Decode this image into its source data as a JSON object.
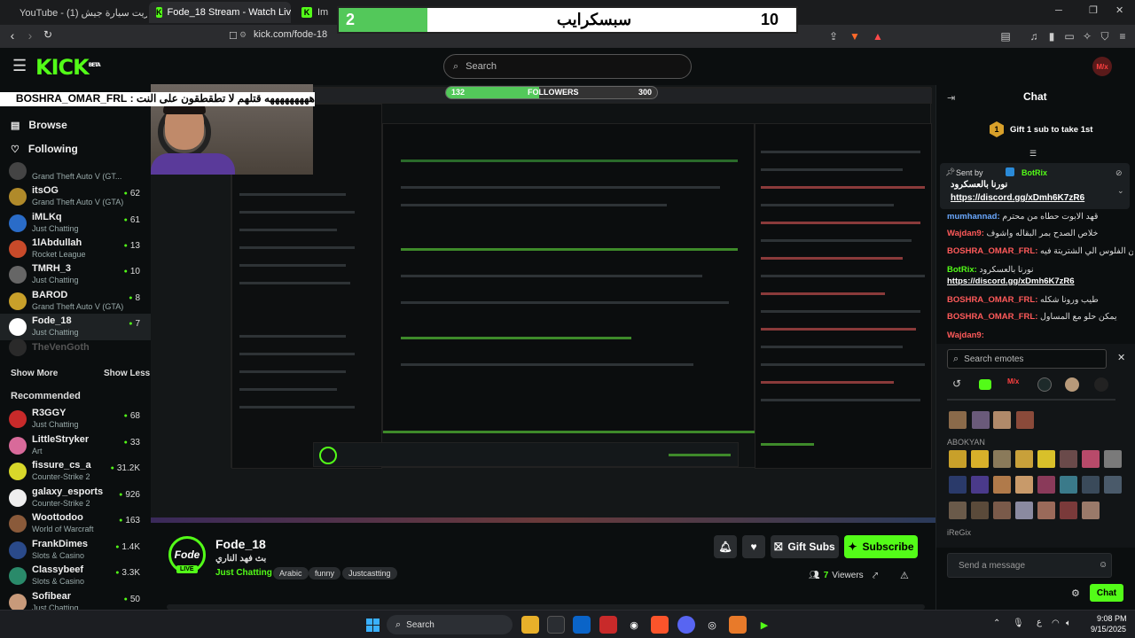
{
  "browser": {
    "tabs": [
      {
        "label": "YouTube - شريت سيارة جيش (1)"
      },
      {
        "label": "Fode_18 Stream - Watch Live"
      },
      {
        "label": "Im"
      }
    ],
    "url": "kick.com/fode-18",
    "new_tab": "+"
  },
  "scoreboard": {
    "left_value": "2",
    "title": "سبسكرايب",
    "right_value": "10"
  },
  "header": {
    "logo": "KICK",
    "logo_badge": "BETA",
    "search_placeholder": "Search",
    "avatar_text": "M/x"
  },
  "sidebar": {
    "browse": "Browse",
    "following": "Following",
    "followed_channels": [
      {
        "name": "",
        "category": "Grand Theft Auto V (GT...",
        "viewers": "",
        "color": "#444"
      },
      {
        "name": "itsOG",
        "category": "Grand Theft Auto V (GTA)",
        "viewers": "62",
        "color": "#b08a2a"
      },
      {
        "name": "iMLKq",
        "category": "Just Chatting",
        "viewers": "61",
        "color": "#2a6cc8"
      },
      {
        "name": "1lAbdullah",
        "category": "Rocket League",
        "viewers": "13",
        "color": "#c84a2a"
      },
      {
        "name": "TMRH_3",
        "category": "Just Chatting",
        "viewers": "10",
        "color": "#666"
      },
      {
        "name": "BAROD",
        "category": "Grand Theft Auto V (GTA)",
        "viewers": "8",
        "color": "#c8a02a"
      },
      {
        "name": "Fode_18",
        "category": "Just Chatting",
        "viewers": "7",
        "color": "#fff"
      }
    ],
    "offline_channel": "TheVenGoth",
    "show_more": "Show More",
    "show_less": "Show Less",
    "recommended_title": "Recommended",
    "recommended": [
      {
        "name": "R3GGY",
        "category": "Just Chatting",
        "viewers": "68",
        "color": "#c82a2a"
      },
      {
        "name": "LittleStryker",
        "category": "Art",
        "viewers": "33",
        "color": "#d86a9a"
      },
      {
        "name": "fissure_cs_a",
        "category": "Counter-Strike 2",
        "viewers": "31.2K",
        "color": "#d8d82a"
      },
      {
        "name": "galaxy_esports",
        "category": "Counter-Strike 2",
        "viewers": "926",
        "color": "#eee"
      },
      {
        "name": "Woottodoo",
        "category": "World of Warcraft",
        "viewers": "163",
        "color": "#8a5a3a"
      },
      {
        "name": "FrankDimes",
        "category": "Slots & Casino",
        "viewers": "1.4K",
        "color": "#2a4a8a"
      },
      {
        "name": "Classybeef",
        "category": "Slots & Casino",
        "viewers": "3.3K",
        "color": "#2a8a6a"
      },
      {
        "name": "Sofibear",
        "category": "Just Chatting",
        "viewers": "50",
        "color": "#c89a7a"
      }
    ]
  },
  "overlay": {
    "ticker": "هههههههههه قتلهم لا تطقطقون على النت : BOSHRA_OMAR_FRL",
    "followers_label": "FOLLOWERS",
    "followers_current": "132",
    "followers_goal": "300",
    "followers_progress": 0.44
  },
  "stream": {
    "avatar_text": "Fode",
    "live": "LIVE",
    "name": "Fode_18",
    "title": "بث فهد الناري",
    "category": "Just Chatting",
    "tags": [
      "Arabic",
      "funny",
      "Justcastting"
    ],
    "gift_subs": "Gift Subs",
    "subscribe": "Subscribe",
    "viewers": "7",
    "viewers_label": "Viewers"
  },
  "chat": {
    "title": "Chat",
    "gift_banner": "Gift 1 sub to take 1st",
    "gift_count": "1",
    "pinned_by": "Sent by",
    "pinned_user": "BotRix",
    "pinned_text": "نورنا بالعسكرود",
    "pinned_link": "https://discord.gg/xDmh6K7zR6",
    "messages": [
      {
        "user": "mumhannad:",
        "text": "قهد الابوت حطاه من محترم",
        "user_color": "#6aa8ff"
      },
      {
        "user": "Wajdan9:",
        "text": "خلاص الصدح بمر البقاله واشوف",
        "user_color": "#ff5a5a"
      },
      {
        "user": "BOSHRA_OMAR_FRL:",
        "text": "دمنين الفلوس الي الشتريتة فيه",
        "user_color": "#ff5a5a"
      },
      {
        "user": "BotRix:",
        "text": "نورنا بالعسكرود",
        "user_color": "#53fc18"
      },
      {
        "user": "",
        "text": "https://discord.gg/xDmh6K7zR6",
        "user_color": "#ffffff"
      },
      {
        "user": "BOSHRA_OMAR_FRL:",
        "text": "طيب ورونا شكله",
        "user_color": "#ff5a5a"
      },
      {
        "user": "BOSHRA_OMAR_FRL:",
        "text": "يمكن حلو مع المساول",
        "user_color": "#ff5a5a"
      },
      {
        "user": "Wajdan9:",
        "text": "",
        "user_color": "#ff5a5a"
      }
    ],
    "emote_search_placeholder": "Search emotes",
    "emote_section_1": "ABOKYAN",
    "emote_section_2": "iReGix",
    "send_placeholder": "Send a message",
    "chat_button": "Chat"
  },
  "taskbar": {
    "search": "Search",
    "time": "9:08 PM",
    "date": "9/15/2025",
    "lang": "ع"
  }
}
